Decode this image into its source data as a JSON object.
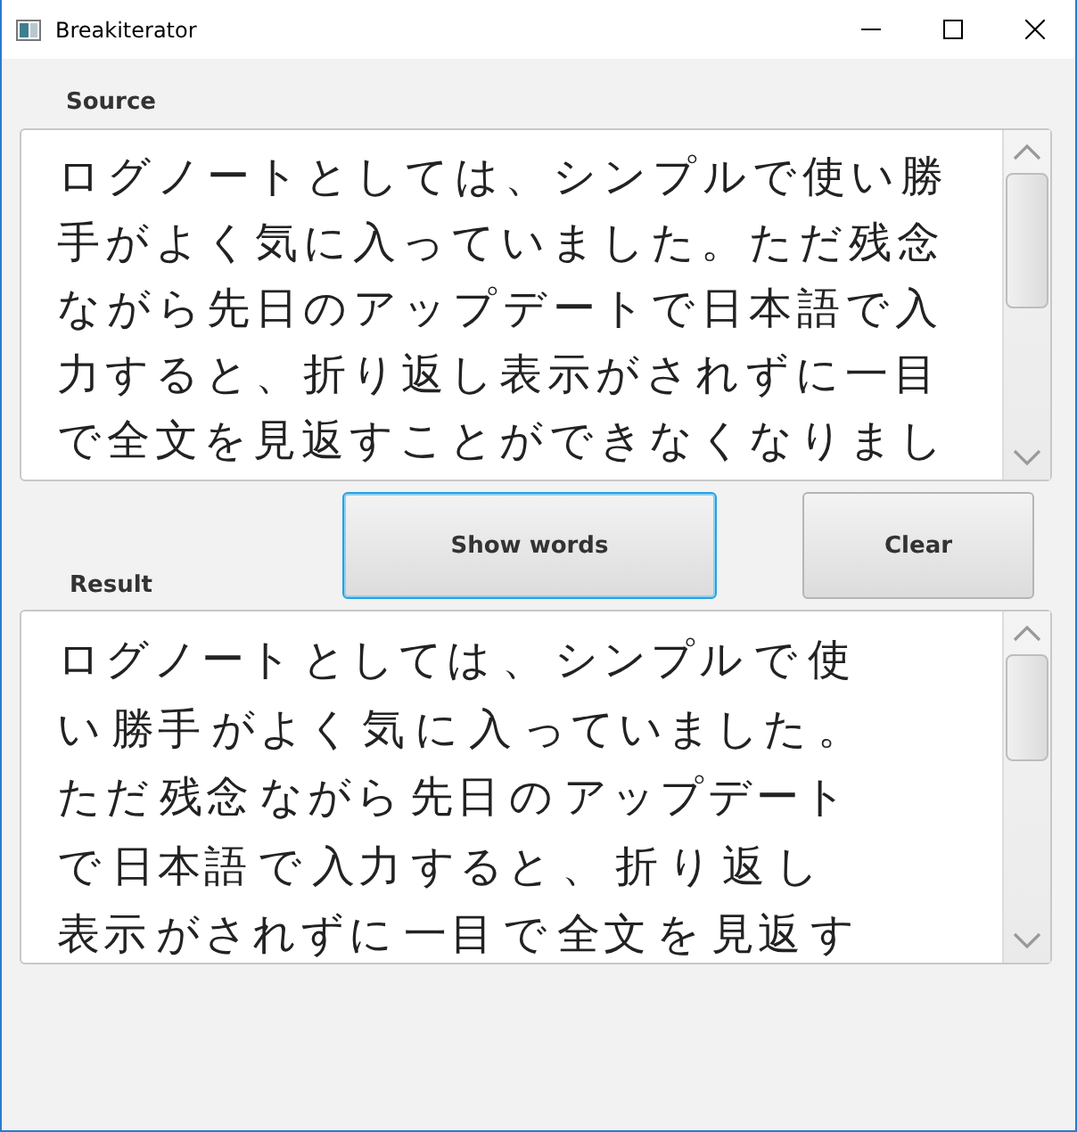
{
  "window": {
    "title": "Breakiterator"
  },
  "source": {
    "label": "Source",
    "lines": [
      "ログノートとしては、シンプルで使い勝",
      "手がよく気に入っていました。ただ残念",
      "ながら先日のアップデートで日本語で入",
      "力すると、折り返し表示がされずに一目",
      "で全文を見返すことができなくなりまし"
    ]
  },
  "buttons": [
    {
      "label": "Show words",
      "focused": true
    },
    {
      "label": "Clear",
      "focused": false
    }
  ],
  "result": {
    "label": "Result",
    "lines": [
      "ログノート としては 、 シンプル で 使",
      "い 勝手 がよく 気 に 入 っていました 。",
      "ただ 残念 ながら 先日 の アップデート",
      "で 日本語 で 入力 すると 、 折 り 返 し",
      "表示 がされずに 一目 で 全文 を 見返 す"
    ]
  }
}
